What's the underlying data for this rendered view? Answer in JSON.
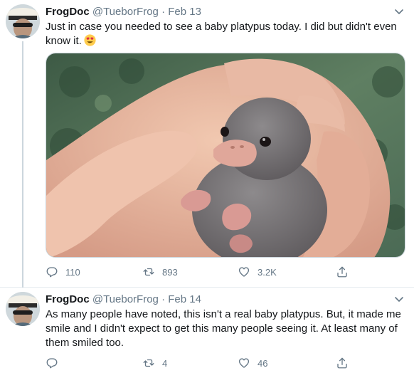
{
  "tweets": [
    {
      "author": {
        "name": "FrogDoc",
        "handle": "@TueborFrog"
      },
      "separator": "·",
      "date": "Feb 13",
      "text": "Just in case you needed to see a baby platypus today. I did but didn't even know it.",
      "emoji": "heart-eyes-emoji",
      "media": {
        "description_icon": "photo-baby-platypus-in-hand"
      },
      "actions": {
        "reply": "110",
        "retweet": "893",
        "like": "3.2K",
        "share": ""
      }
    },
    {
      "author": {
        "name": "FrogDoc",
        "handle": "@TueborFrog"
      },
      "separator": "·",
      "date": "Feb 14",
      "text": "As many people have noted, this isn't a real baby platypus. But, it made me smile and I didn't expect to get this many people seeing it. At least many of them smiled too.",
      "actions": {
        "reply": "",
        "retweet": "4",
        "like": "46",
        "share": ""
      }
    }
  ],
  "colors": {
    "text": "#14171a",
    "secondary": "#657786",
    "border": "#e6ecf0",
    "thread": "#ccd6dd"
  },
  "icons": [
    "reply-icon",
    "retweet-icon",
    "like-icon",
    "share-icon",
    "caret-down-icon"
  ]
}
